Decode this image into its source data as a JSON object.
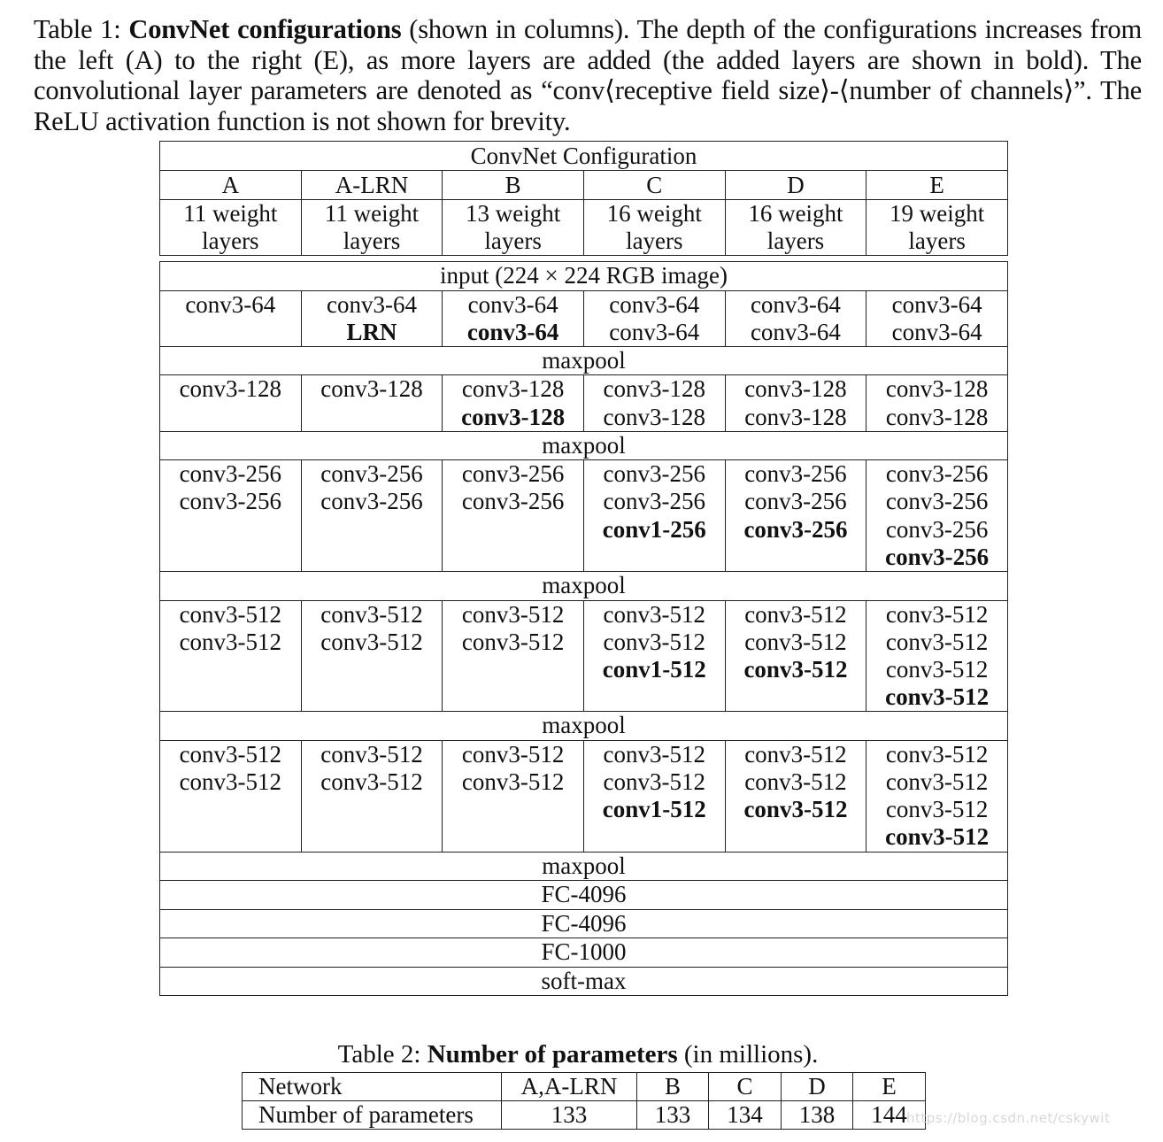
{
  "table1": {
    "caption": {
      "label": "Table 1:",
      "bold": "ConvNet configurations",
      "rest": "(shown in columns). The depth of the configurations increases from the left (A) to the right (E), as more layers are added (the added layers are shown in bold). The convolutional layer parameters are denoted as “conv⟨receptive field size⟩-⟨number of channels⟩”. The ReLU activation function is not shown for brevity."
    },
    "title": "ConvNet Configuration",
    "columns": [
      {
        "name": "A",
        "depth_line1": "11 weight",
        "depth_line2": "layers"
      },
      {
        "name": "A-LRN",
        "depth_line1": "11 weight",
        "depth_line2": "layers"
      },
      {
        "name": "B",
        "depth_line1": "13 weight",
        "depth_line2": "layers"
      },
      {
        "name": "C",
        "depth_line1": "16 weight",
        "depth_line2": "layers"
      },
      {
        "name": "D",
        "depth_line1": "16 weight",
        "depth_line2": "layers"
      },
      {
        "name": "E",
        "depth_line1": "19 weight",
        "depth_line2": "layers"
      }
    ],
    "input_row": "input (224 × 224 RGB image)",
    "blocks": [
      {
        "cells": [
          [
            {
              "t": "conv3-64",
              "b": false
            }
          ],
          [
            {
              "t": "conv3-64",
              "b": false
            },
            {
              "t": "LRN",
              "b": true
            }
          ],
          [
            {
              "t": "conv3-64",
              "b": false
            },
            {
              "t": "conv3-64",
              "b": true
            }
          ],
          [
            {
              "t": "conv3-64",
              "b": false
            },
            {
              "t": "conv3-64",
              "b": false
            }
          ],
          [
            {
              "t": "conv3-64",
              "b": false
            },
            {
              "t": "conv3-64",
              "b": false
            }
          ],
          [
            {
              "t": "conv3-64",
              "b": false
            },
            {
              "t": "conv3-64",
              "b": false
            }
          ]
        ],
        "lines": 2,
        "pool": "maxpool"
      },
      {
        "cells": [
          [
            {
              "t": "conv3-128",
              "b": false
            }
          ],
          [
            {
              "t": "conv3-128",
              "b": false
            }
          ],
          [
            {
              "t": "conv3-128",
              "b": false
            },
            {
              "t": "conv3-128",
              "b": true
            }
          ],
          [
            {
              "t": "conv3-128",
              "b": false
            },
            {
              "t": "conv3-128",
              "b": false
            }
          ],
          [
            {
              "t": "conv3-128",
              "b": false
            },
            {
              "t": "conv3-128",
              "b": false
            }
          ],
          [
            {
              "t": "conv3-128",
              "b": false
            },
            {
              "t": "conv3-128",
              "b": false
            }
          ]
        ],
        "lines": 2,
        "pool": "maxpool"
      },
      {
        "cells": [
          [
            {
              "t": "conv3-256",
              "b": false
            },
            {
              "t": "conv3-256",
              "b": false
            }
          ],
          [
            {
              "t": "conv3-256",
              "b": false
            },
            {
              "t": "conv3-256",
              "b": false
            }
          ],
          [
            {
              "t": "conv3-256",
              "b": false
            },
            {
              "t": "conv3-256",
              "b": false
            }
          ],
          [
            {
              "t": "conv3-256",
              "b": false
            },
            {
              "t": "conv3-256",
              "b": false
            },
            {
              "t": "conv1-256",
              "b": true
            }
          ],
          [
            {
              "t": "conv3-256",
              "b": false
            },
            {
              "t": "conv3-256",
              "b": false
            },
            {
              "t": "conv3-256",
              "b": true
            }
          ],
          [
            {
              "t": "conv3-256",
              "b": false
            },
            {
              "t": "conv3-256",
              "b": false
            },
            {
              "t": "conv3-256",
              "b": false
            },
            {
              "t": "conv3-256",
              "b": true
            }
          ]
        ],
        "lines": 4,
        "pool": "maxpool"
      },
      {
        "cells": [
          [
            {
              "t": "conv3-512",
              "b": false
            },
            {
              "t": "conv3-512",
              "b": false
            }
          ],
          [
            {
              "t": "conv3-512",
              "b": false
            },
            {
              "t": "conv3-512",
              "b": false
            }
          ],
          [
            {
              "t": "conv3-512",
              "b": false
            },
            {
              "t": "conv3-512",
              "b": false
            }
          ],
          [
            {
              "t": "conv3-512",
              "b": false
            },
            {
              "t": "conv3-512",
              "b": false
            },
            {
              "t": "conv1-512",
              "b": true
            }
          ],
          [
            {
              "t": "conv3-512",
              "b": false
            },
            {
              "t": "conv3-512",
              "b": false
            },
            {
              "t": "conv3-512",
              "b": true
            }
          ],
          [
            {
              "t": "conv3-512",
              "b": false
            },
            {
              "t": "conv3-512",
              "b": false
            },
            {
              "t": "conv3-512",
              "b": false
            },
            {
              "t": "conv3-512",
              "b": true
            }
          ]
        ],
        "lines": 4,
        "pool": "maxpool"
      },
      {
        "cells": [
          [
            {
              "t": "conv3-512",
              "b": false
            },
            {
              "t": "conv3-512",
              "b": false
            }
          ],
          [
            {
              "t": "conv3-512",
              "b": false
            },
            {
              "t": "conv3-512",
              "b": false
            }
          ],
          [
            {
              "t": "conv3-512",
              "b": false
            },
            {
              "t": "conv3-512",
              "b": false
            }
          ],
          [
            {
              "t": "conv3-512",
              "b": false
            },
            {
              "t": "conv3-512",
              "b": false
            },
            {
              "t": "conv1-512",
              "b": true
            }
          ],
          [
            {
              "t": "conv3-512",
              "b": false
            },
            {
              "t": "conv3-512",
              "b": false
            },
            {
              "t": "conv3-512",
              "b": true
            }
          ],
          [
            {
              "t": "conv3-512",
              "b": false
            },
            {
              "t": "conv3-512",
              "b": false
            },
            {
              "t": "conv3-512",
              "b": false
            },
            {
              "t": "conv3-512",
              "b": true
            }
          ]
        ],
        "lines": 4,
        "pool": "maxpool"
      }
    ],
    "tail_rows": [
      "FC-4096",
      "FC-4096",
      "FC-1000",
      "soft-max"
    ]
  },
  "table2": {
    "caption": {
      "label": "Table 2:",
      "bold": "Number of parameters",
      "rest": "(in millions)."
    },
    "header": [
      "Network",
      "A,A-LRN",
      "B",
      "C",
      "D",
      "E"
    ],
    "row": [
      "Number of parameters",
      "133",
      "133",
      "134",
      "138",
      "144"
    ]
  },
  "watermark": "https://blog.csdn.net/cskywit"
}
